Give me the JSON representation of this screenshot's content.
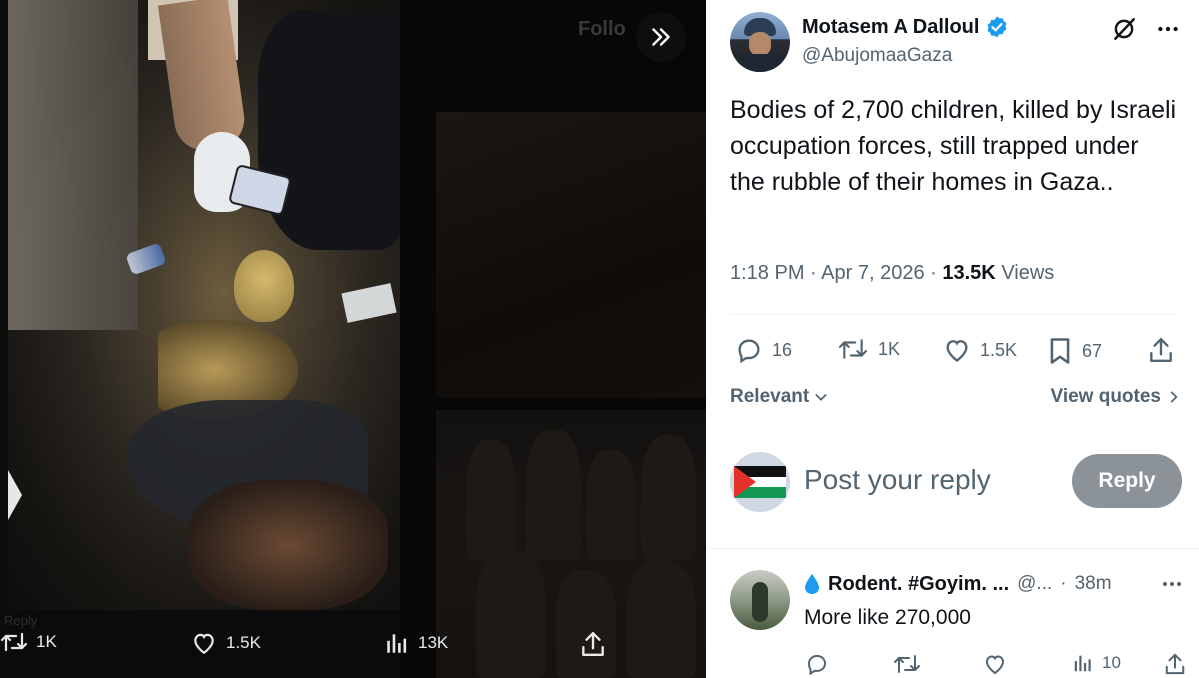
{
  "media": {
    "background_follow": "Follo",
    "background_reply": "Reply",
    "actions": {
      "retweets": "1K",
      "likes": "1.5K",
      "views": "13K"
    }
  },
  "tweet": {
    "author": {
      "display_name": "Motasem A Dalloul",
      "handle": "@AbujomaaGaza",
      "verified": true
    },
    "text": "Bodies of 2,700 children, killed by Israeli occupation forces, still trapped under the rubble of their homes in Gaza..",
    "time": "1:18 PM",
    "date": "Apr 7, 2026",
    "views_count": "13.5K",
    "views_label": "Views",
    "stats": {
      "replies": "16",
      "retweets": "1K",
      "likes": "1.5K",
      "bookmarks": "67"
    },
    "sort_label": "Relevant",
    "view_quotes_label": "View quotes",
    "reply_placeholder": "Post your reply",
    "reply_button": "Reply"
  },
  "replies": [
    {
      "display_name": "Rodent. #Goyim. ...",
      "handle": "@...",
      "time": "38m",
      "text": "More like 270,000",
      "views": "10"
    }
  ],
  "colors": {
    "verified_blue": "#1d9bf0",
    "secondary_text": "#536471",
    "reply_button_bg": "#8b9298",
    "water_drop": "#1d9bf0"
  },
  "icons": [
    "expand-icon",
    "verified-badge-icon",
    "grok-icon",
    "more-icon",
    "reply-icon",
    "retweet-icon",
    "like-icon",
    "bookmark-icon",
    "share-icon",
    "views-icon",
    "chevron-down-icon",
    "chevron-right-icon",
    "water-drop-icon",
    "play-arrow-icon"
  ]
}
